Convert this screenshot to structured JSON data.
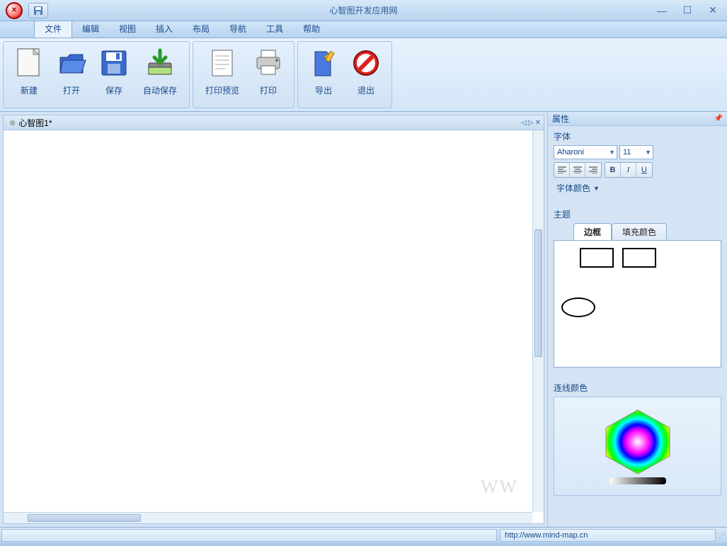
{
  "app": {
    "title": "心智图开发应用网",
    "url": "http://www.mind-map.cn"
  },
  "menu": {
    "items": [
      "文件",
      "编辑",
      "视图",
      "插入",
      "布局",
      "导航",
      "工具",
      "帮助"
    ],
    "active_index": 0
  },
  "ribbon": {
    "groups": [
      {
        "buttons": [
          {
            "id": "new",
            "label": "新建"
          },
          {
            "id": "open",
            "label": "打开"
          },
          {
            "id": "save",
            "label": "保存"
          },
          {
            "id": "autosave",
            "label": "自动保存"
          }
        ]
      },
      {
        "buttons": [
          {
            "id": "print-preview",
            "label": "打印预览"
          },
          {
            "id": "print",
            "label": "打印"
          }
        ]
      },
      {
        "buttons": [
          {
            "id": "export",
            "label": "导出"
          },
          {
            "id": "exit",
            "label": "退出"
          }
        ]
      }
    ]
  },
  "document": {
    "tab_name": "心智图1*"
  },
  "properties": {
    "panel_title": "属性",
    "font_section": "字体",
    "font_name": "Aharoni",
    "font_size": "11",
    "font_color_label": "字体颜色",
    "theme_section": "主题",
    "theme_tabs": [
      "边框",
      "填充颜色"
    ],
    "line_section": "连线颜色"
  },
  "watermark": "WW"
}
